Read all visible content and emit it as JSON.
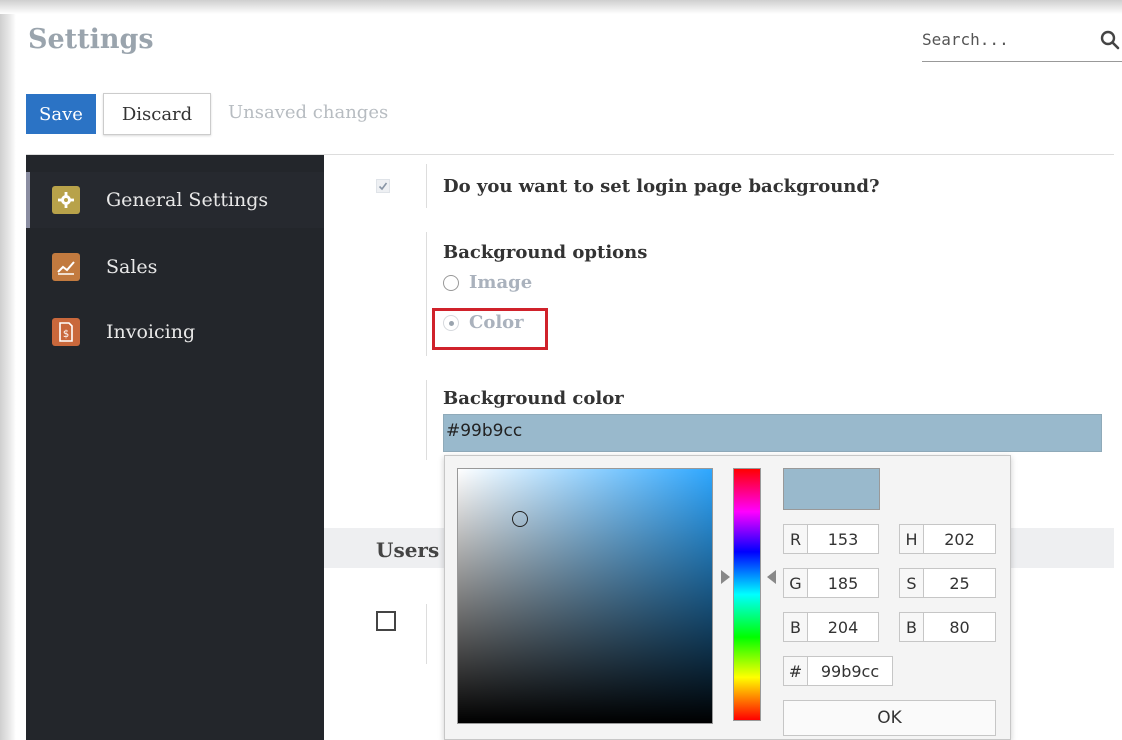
{
  "header": {
    "title": "Settings",
    "search_placeholder": "Search..."
  },
  "toolbar": {
    "save_label": "Save",
    "discard_label": "Discard",
    "status_text": "Unsaved changes"
  },
  "sidebar": {
    "items": [
      {
        "label": "General Settings",
        "icon": "gear-icon",
        "color": "#b8a24a",
        "active": true
      },
      {
        "label": "Sales",
        "icon": "chart-icon",
        "color": "#c27a3f",
        "active": false
      },
      {
        "label": "Invoicing",
        "icon": "invoice-icon",
        "color": "#c9683c",
        "active": false
      }
    ]
  },
  "settings": {
    "login_background_question": "Do you want to set login page background?",
    "login_background_checked": true,
    "background_options_label": "Background options",
    "options": [
      {
        "label": "Image",
        "checked": false
      },
      {
        "label": "Color",
        "checked": true
      }
    ],
    "background_color_label": "Background color",
    "background_color_value": "#99b9cc",
    "users_section": "Users"
  },
  "color_picker": {
    "current_color": "#99b9cc",
    "r": {
      "label": "R",
      "value": "153"
    },
    "g": {
      "label": "G",
      "value": "185"
    },
    "b": {
      "label": "B",
      "value": "204"
    },
    "h": {
      "label": "H",
      "value": "202"
    },
    "s": {
      "label": "S",
      "value": "25"
    },
    "v": {
      "label": "B",
      "value": "80"
    },
    "hex": {
      "label": "#",
      "value": "99b9cc"
    },
    "ok_label": "OK"
  },
  "colors": {
    "save_button": "#2b73c5",
    "sidebar_bg": "#23262b",
    "highlight_border": "#d0222b"
  }
}
